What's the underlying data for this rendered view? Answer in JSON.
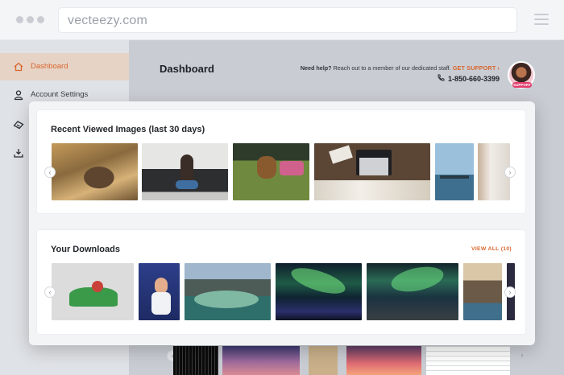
{
  "browser": {
    "url": "vecteezy.com",
    "menu_icon": "hamburger-icon"
  },
  "sidebar": {
    "items": [
      {
        "label": "Dashboard",
        "icon": "home-icon",
        "active": true
      },
      {
        "label": "Account Settings",
        "icon": "user-icon",
        "active": false
      },
      {
        "label": "",
        "icon": "ticket-icon",
        "active": false
      },
      {
        "label": "",
        "icon": "download-icon",
        "active": false
      }
    ]
  },
  "header": {
    "title": "Dashboard",
    "help_bold": "Need help?",
    "help_text": "Reach out to a member of our dedicated staff.",
    "help_link": "GET SUPPORT",
    "help_arrow": "›",
    "phone": "1-850-660-3399",
    "avatar_badge": "SUPPORT"
  },
  "recent": {
    "title": "Recent Viewed Images (last 30 days)",
    "prev": "‹",
    "next": "›"
  },
  "downloads": {
    "title": "Your Downloads",
    "view_all": "VIEW ALL (10)",
    "prev": "‹",
    "next": "›"
  },
  "bottom_strip": {
    "prev": "‹",
    "next": "›"
  },
  "colors": {
    "accent": "#d9652d",
    "active_bg": "#e6d3c6"
  }
}
